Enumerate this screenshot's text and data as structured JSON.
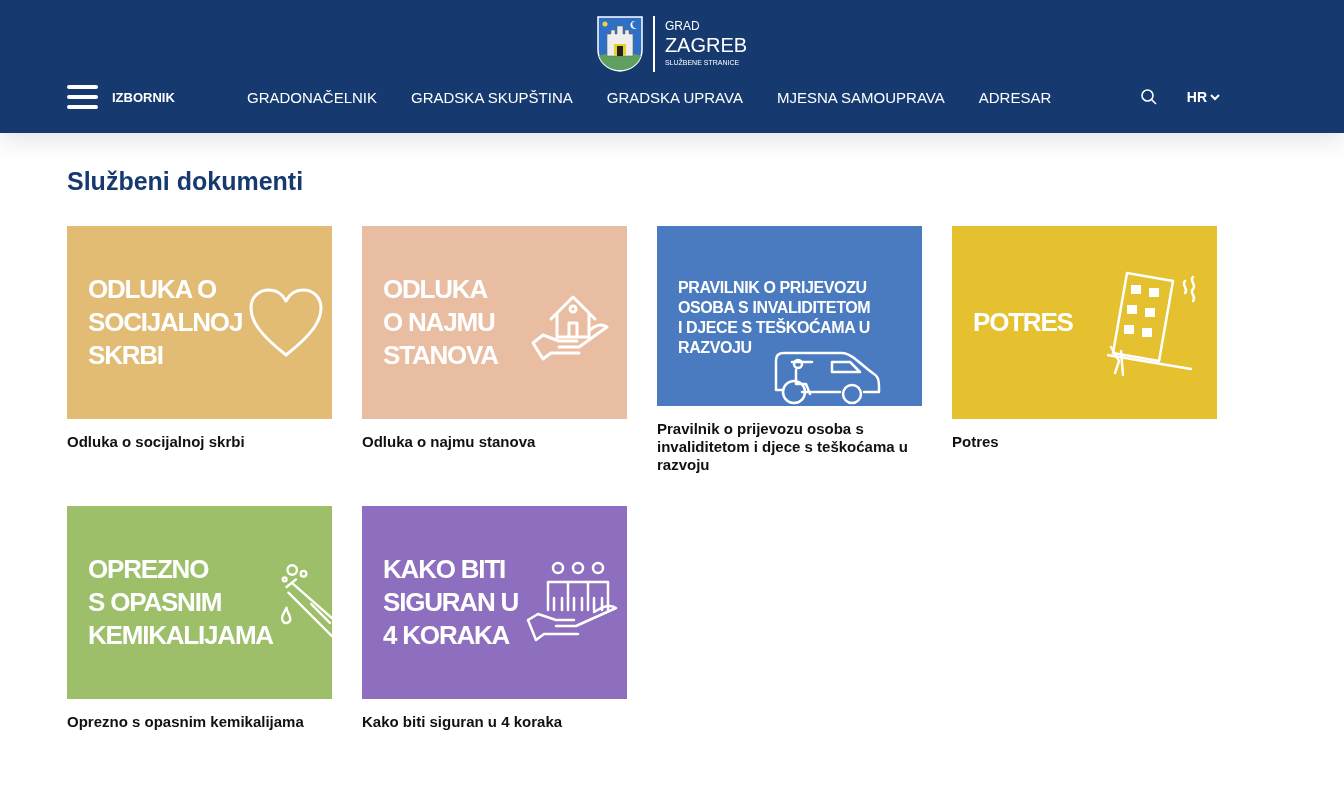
{
  "logo": {
    "small": "GRAD",
    "city": "ZAGREB",
    "subtitle": "SLUŽBENE STRANICE"
  },
  "menu_label": "IZBORNIK",
  "nav": [
    "GRADONAČELNIK",
    "GRADSKA SKUPŠTINA",
    "GRADSKA UPRAVA",
    "MJESNA SAMOUPRAVA",
    "ADRESAR"
  ],
  "language": "HR",
  "heading": "Službeni dokumenti",
  "cards": [
    {
      "color": "#e2bb74",
      "banner": [
        "ODLUKA O",
        "SOCIJALNOJ",
        "SKRBI"
      ],
      "kind": "heart",
      "caption": "Odluka o socijalnoj skrbi"
    },
    {
      "color": "#e8bda1",
      "banner": [
        "ODLUKA",
        "O NAJMU",
        "STANOVA"
      ],
      "kind": "house-hand",
      "caption": "Odluka o najmu stanova"
    },
    {
      "color": "#4a7abf",
      "banner": [
        "PRAVILNIK O PRIJEVOZU",
        "OSOBA S INVALIDITETOM",
        "I DJECE S TEŠKOĆAMA U",
        "RAZVOJU"
      ],
      "kind": "van",
      "caption": "Pravilnik o prijevozu osoba s invaliditetom i djece s teškoćama u razvoju"
    },
    {
      "color": "#e5c02f",
      "banner": [
        "POTRES"
      ],
      "kind": "building",
      "caption": "Potres"
    },
    {
      "color": "#9dbf6a",
      "banner": [
        "OPREZNO",
        "S OPASNIM",
        "KEMIKALIJAMA"
      ],
      "kind": "test-tube",
      "caption": "Oprezno s opasnim kemikalijama"
    },
    {
      "color": "#8e6fbf",
      "banner": [
        "KAKO BITI",
        "SIGURAN U",
        "4 KORAKA"
      ],
      "kind": "people-hand",
      "caption": "Kako biti siguran u 4 koraka"
    }
  ]
}
